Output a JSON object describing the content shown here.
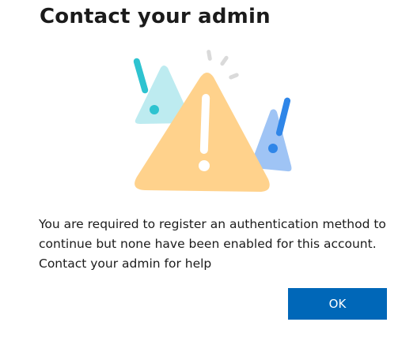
{
  "dialog": {
    "title": "Contact your admin",
    "message": "You are required to register an authentication method to continue but none have been enabled for this account. Contact your admin for help",
    "ok_label": "OK",
    "illustration_icon": "warning-triangle-icon"
  },
  "colors": {
    "primary_button": "#0067b8",
    "warning_main": "#ffd28c",
    "warning_left": "#bdebf0",
    "warning_right": "#9fc4f5",
    "text": "#1b1b1b"
  }
}
